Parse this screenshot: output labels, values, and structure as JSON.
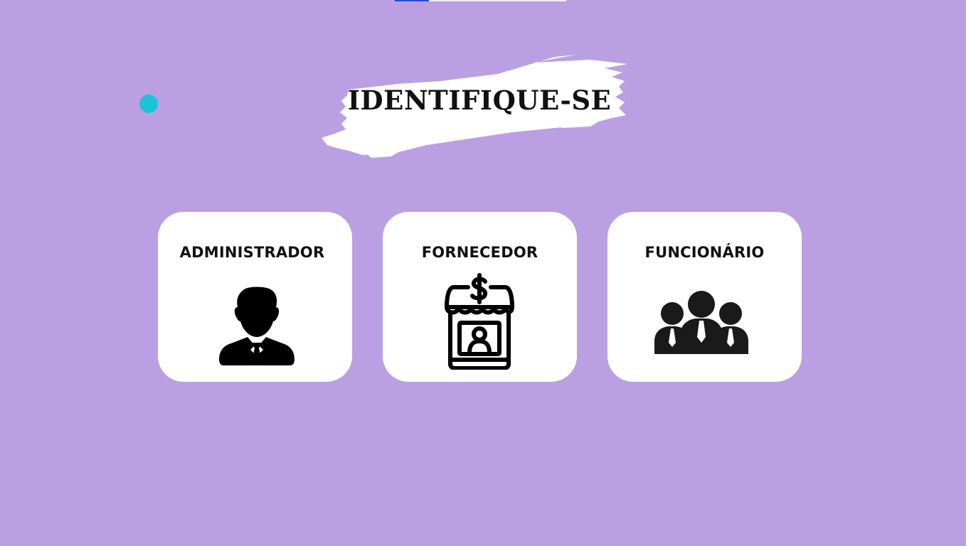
{
  "page": {
    "title": "IDENTIFIQUE-SE",
    "background_color": "#baa0e3",
    "accent_dot_color": "#19c4d6"
  },
  "cards": [
    {
      "label": "ADMINISTRADOR",
      "icon": "businessman-icon"
    },
    {
      "label": "FORNECEDOR",
      "icon": "vendor-stall-icon"
    },
    {
      "label": "FUNCIONÁRIO",
      "icon": "employees-group-icon"
    }
  ]
}
